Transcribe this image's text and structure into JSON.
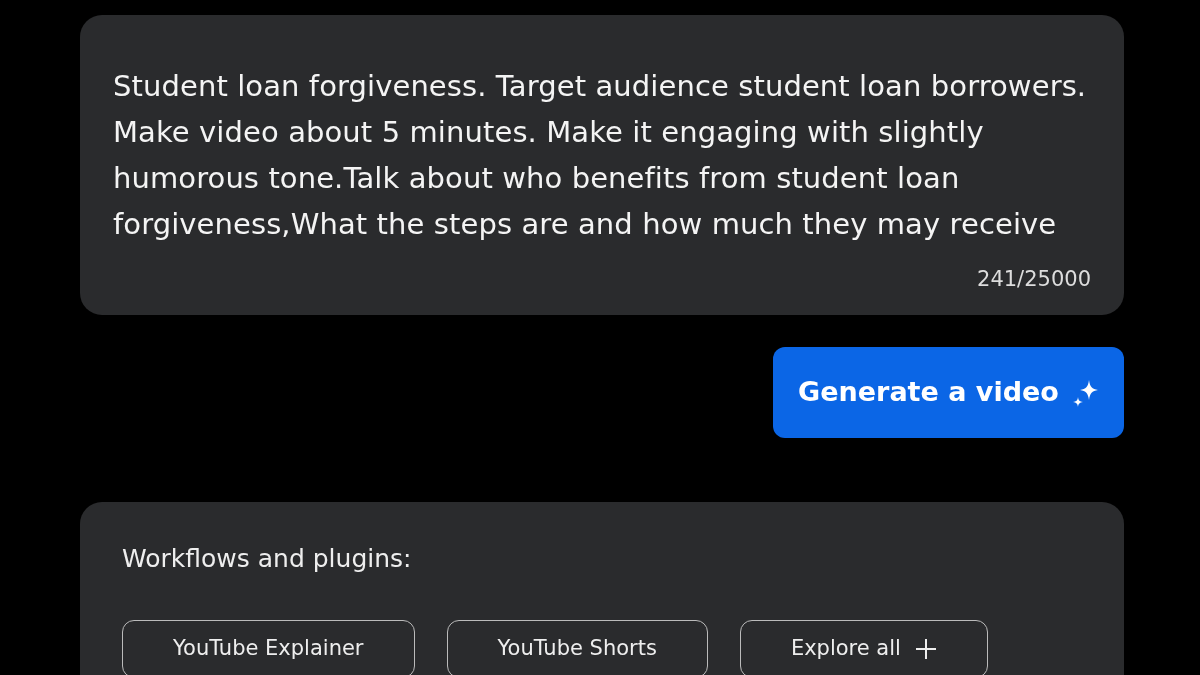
{
  "prompt": {
    "value": "Student loan forgiveness. Target audience student loan borrowers. Make video about 5 minutes. Make it engaging with slightly humorous tone.Talk about who benefits from student loan forgiveness,What the steps are and how much they may receive",
    "counter": "241/25000"
  },
  "generate_button": {
    "label": "Generate a video"
  },
  "workflows": {
    "title": "Workflows and plugins:",
    "items": [
      {
        "label": "YouTube Explainer",
        "kind": "workflow"
      },
      {
        "label": "YouTube Shorts",
        "kind": "workflow"
      },
      {
        "label": "Explore all",
        "kind": "more"
      }
    ]
  }
}
